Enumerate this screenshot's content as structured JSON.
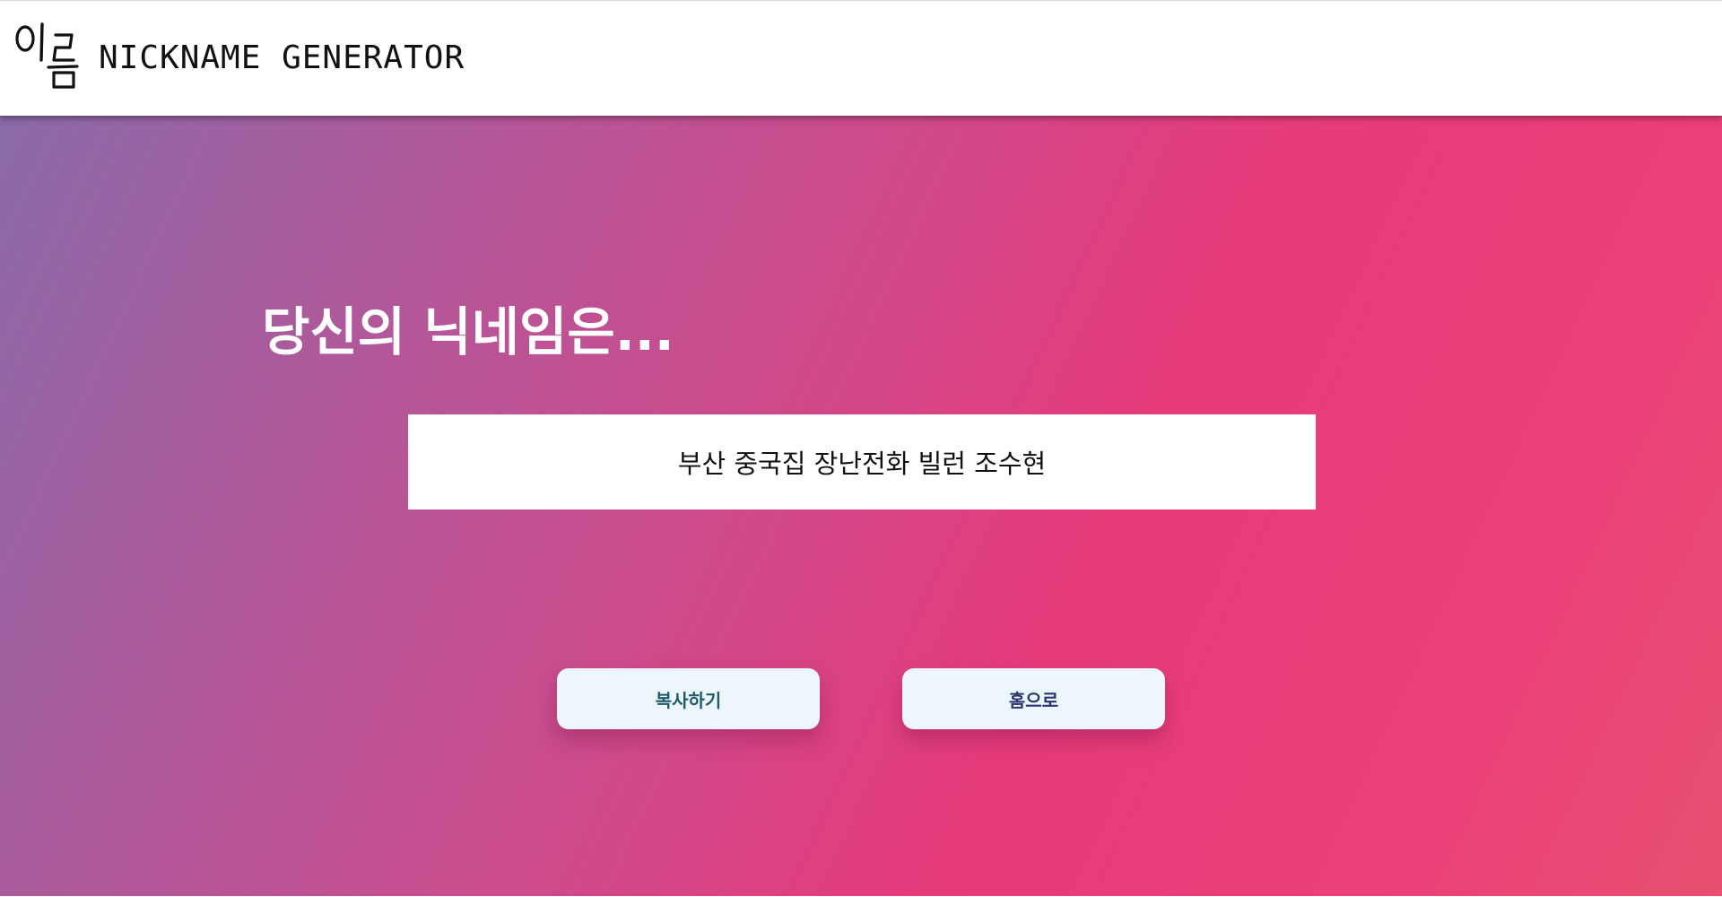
{
  "header": {
    "logo_text": "이름",
    "title": "NICKNAME GENERATOR"
  },
  "main": {
    "heading": "당신의 닉네임은...",
    "nickname": "부산 중국집 장난전화 빌런 조수현",
    "buttons": {
      "copy_label": "복사하기",
      "home_label": "홈으로"
    }
  },
  "colors": {
    "gradient_start": "#8a6aa8",
    "gradient_mid": "#cc4b8c",
    "gradient_end": "#e63b7b",
    "button_bg": "#eef6fd",
    "copy_text": "#1e5a6e",
    "home_text": "#2c3570"
  }
}
